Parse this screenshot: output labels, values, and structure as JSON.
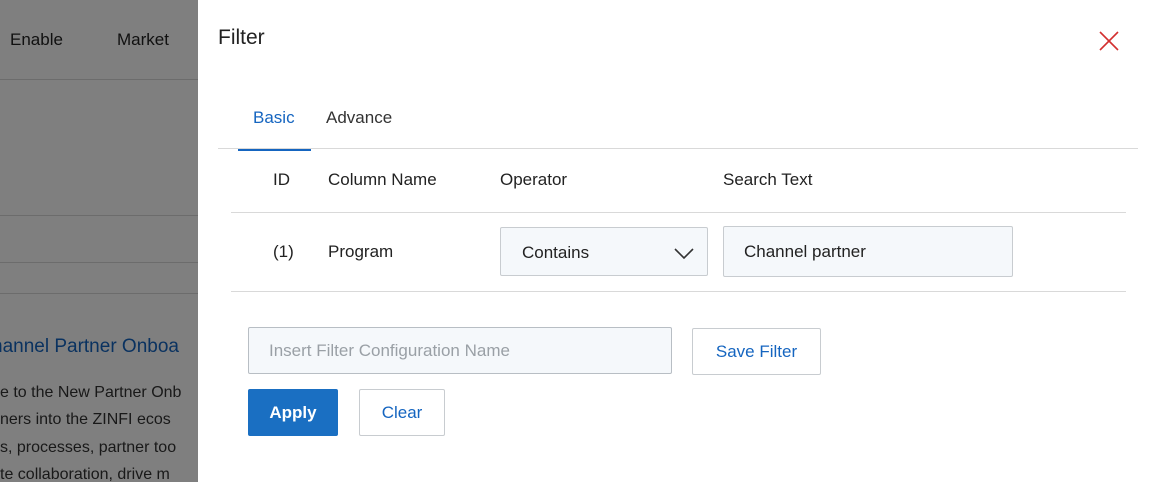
{
  "background": {
    "nav": [
      "Enable",
      "Market"
    ],
    "title": "hannel Partner Onboa",
    "lines": [
      "e to the New Partner Onb",
      "ners into the ZINFI ecos",
      "s, processes, partner too",
      "te collaboration, drive m"
    ]
  },
  "panel": {
    "title": "Filter",
    "tabs": [
      {
        "label": "Basic",
        "active": true
      },
      {
        "label": "Advance",
        "active": false
      }
    ],
    "table": {
      "headers": [
        "ID",
        "Column Name",
        "Operator",
        "Search Text"
      ],
      "rows": [
        {
          "id": "(1)",
          "column": "Program",
          "operator": "Contains",
          "search": "Channel partner"
        }
      ]
    },
    "config_placeholder": "Insert Filter Configuration Name",
    "save_label": "Save Filter",
    "apply_label": "Apply",
    "clear_label": "Clear"
  },
  "colors": {
    "accent": "#1565c0",
    "primary_button": "#1a6fc2",
    "close_icon": "#d32f2f"
  }
}
